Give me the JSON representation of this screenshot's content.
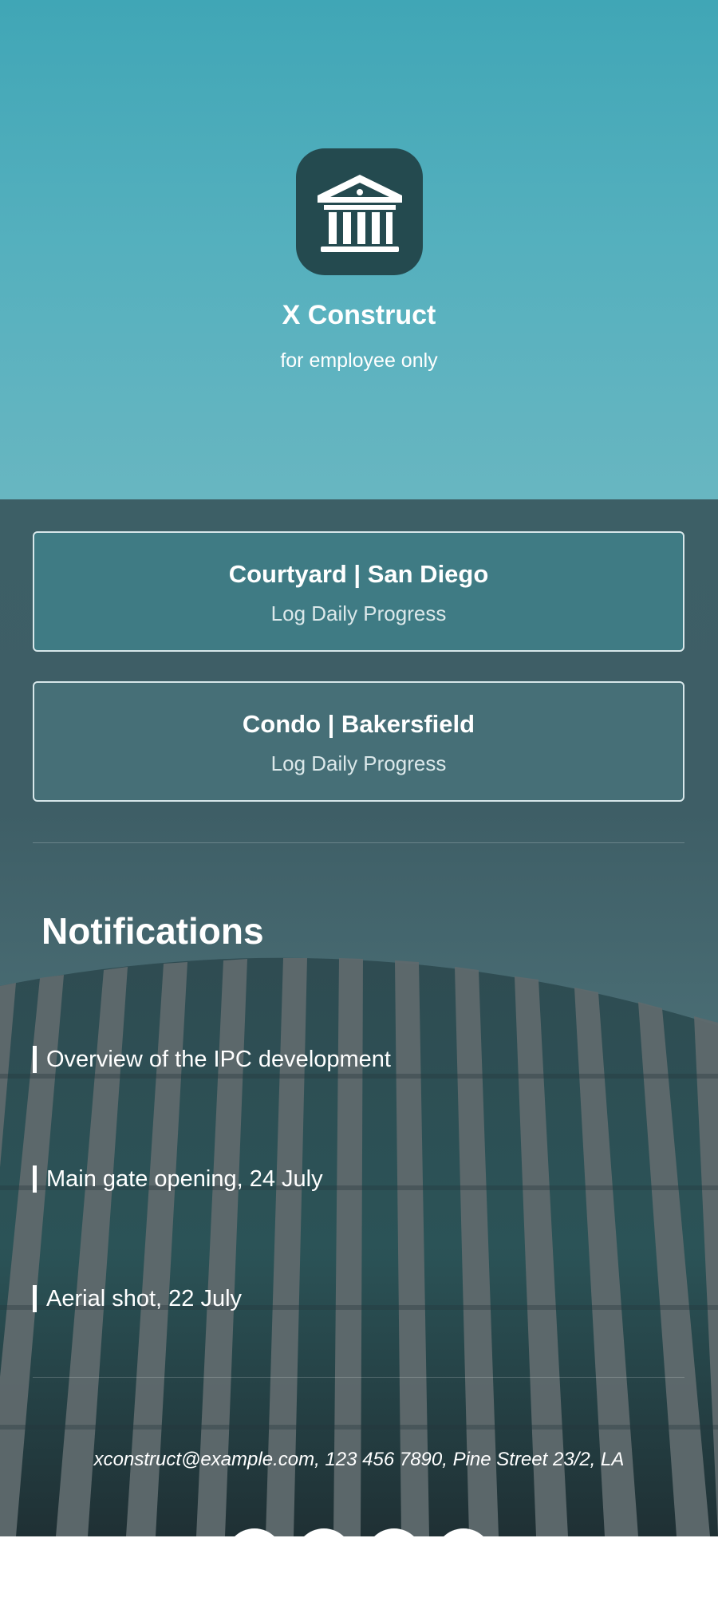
{
  "header": {
    "title": "X Construct",
    "subtitle": "for employee only",
    "logo_icon": "bank-building-icon",
    "colors": {
      "gradient_top": "#40a6b6",
      "gradient_bottom": "#68b6c1",
      "logo_bg": "#244a4f"
    }
  },
  "projects": [
    {
      "title": "Courtyard | San Diego",
      "action": "Log Daily Progress"
    },
    {
      "title": "Condo | Bakersfield",
      "action": "Log Daily Progress"
    }
  ],
  "notifications": {
    "heading": "Notifications",
    "items": [
      "Overview of the IPC development",
      "Main gate opening, 24 July",
      "Aerial shot, 22 July"
    ]
  },
  "footer": {
    "contact": "xconstruct@example.com, 123 456 7890, Pine Street 23/2, LA"
  },
  "social_icons": [
    "social-icon-1",
    "social-icon-2",
    "social-icon-3",
    "social-icon-4"
  ]
}
